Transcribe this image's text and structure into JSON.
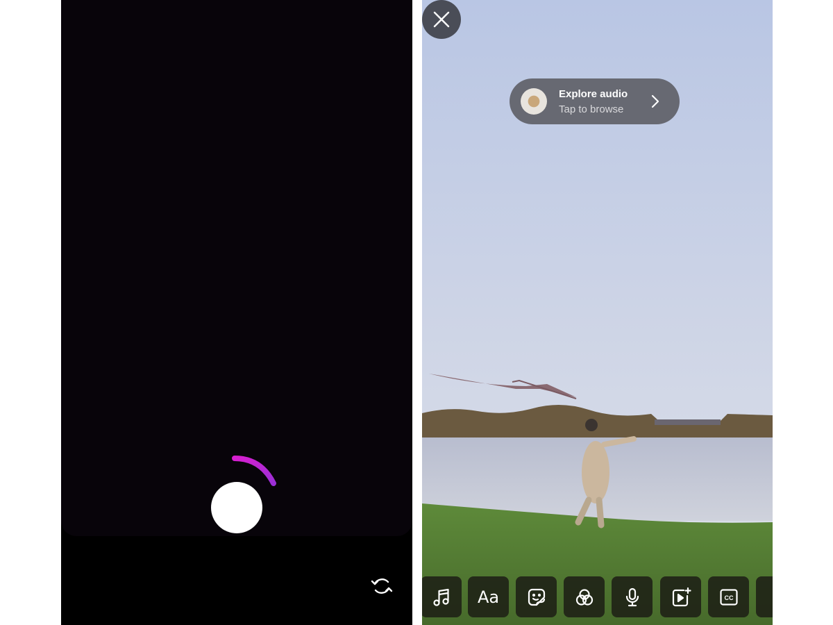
{
  "left_panel": {
    "mode": "camera",
    "shutter": {
      "icon": "record-button",
      "state": "recording"
    },
    "progress_arc": {
      "color_start": "#d81fd0",
      "color_end": "#9b2fd6"
    },
    "flip_camera": {
      "icon": "flip-camera-icon"
    }
  },
  "right_panel": {
    "close": {
      "icon": "close-icon"
    },
    "audio_pill": {
      "title": "Explore audio",
      "subtitle": "Tap to browse",
      "icon": "chevron-right-icon"
    },
    "toolbar": {
      "items": [
        {
          "name": "music",
          "icon": "music-note-icon"
        },
        {
          "name": "text",
          "label": "Aa",
          "icon": "text-icon"
        },
        {
          "name": "sticker",
          "icon": "sticker-icon"
        },
        {
          "name": "effects",
          "icon": "effects-icon"
        },
        {
          "name": "voiceover",
          "icon": "microphone-icon"
        },
        {
          "name": "add-clip",
          "icon": "add-clip-icon"
        },
        {
          "name": "captions",
          "label": "CC",
          "icon": "captions-icon"
        },
        {
          "name": "more",
          "icon": "more-icon"
        }
      ]
    }
  }
}
